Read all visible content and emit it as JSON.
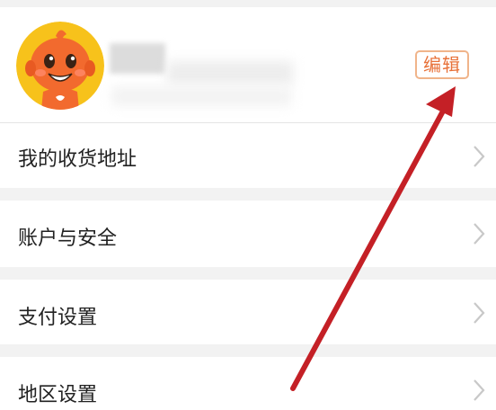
{
  "profile": {
    "edit_label": "编辑"
  },
  "menu": [
    {
      "label": "我的收货地址",
      "icon": "chevron-right-icon"
    },
    {
      "label": "账户与安全",
      "icon": "chevron-right-icon"
    },
    {
      "label": "支付设置",
      "icon": "chevron-right-icon"
    },
    {
      "label": "地区设置",
      "icon": "chevron-right-icon"
    }
  ],
  "colors": {
    "accent": "#e8723a",
    "arrow": "#c42026",
    "background": "#f2f2f2"
  }
}
